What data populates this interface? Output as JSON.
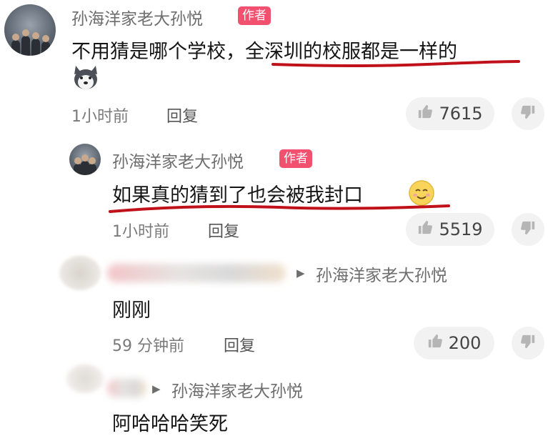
{
  "comment1": {
    "author": "孙海洋家老大孙悦",
    "tag": "作者",
    "text_part1": "不用猜是哪个学校，",
    "text_part2": "全深圳的校服都是一样的",
    "emoji": "husky-emoji",
    "time": "1小时前",
    "reply": "回复",
    "likes": "7615"
  },
  "reply1": {
    "author": "孙海洋家老大孙悦",
    "tag": "作者",
    "text": "如果真的猜到了也会被我封口",
    "emoji": "smile-emoji",
    "time": "1小时前",
    "reply": "回复",
    "likes": "5519"
  },
  "reply2": {
    "reply_to": "孙海洋家老大孙悦",
    "text": "刚刚",
    "time": "59 分钟前",
    "reply": "回复",
    "likes": "200"
  },
  "reply3": {
    "reply_to": "孙海洋家老大孙悦",
    "text": "阿哈哈哈笑死"
  },
  "colors": {
    "tag": "#f1506f",
    "underline": "#c0101a",
    "pill": "#f2f2f2"
  }
}
